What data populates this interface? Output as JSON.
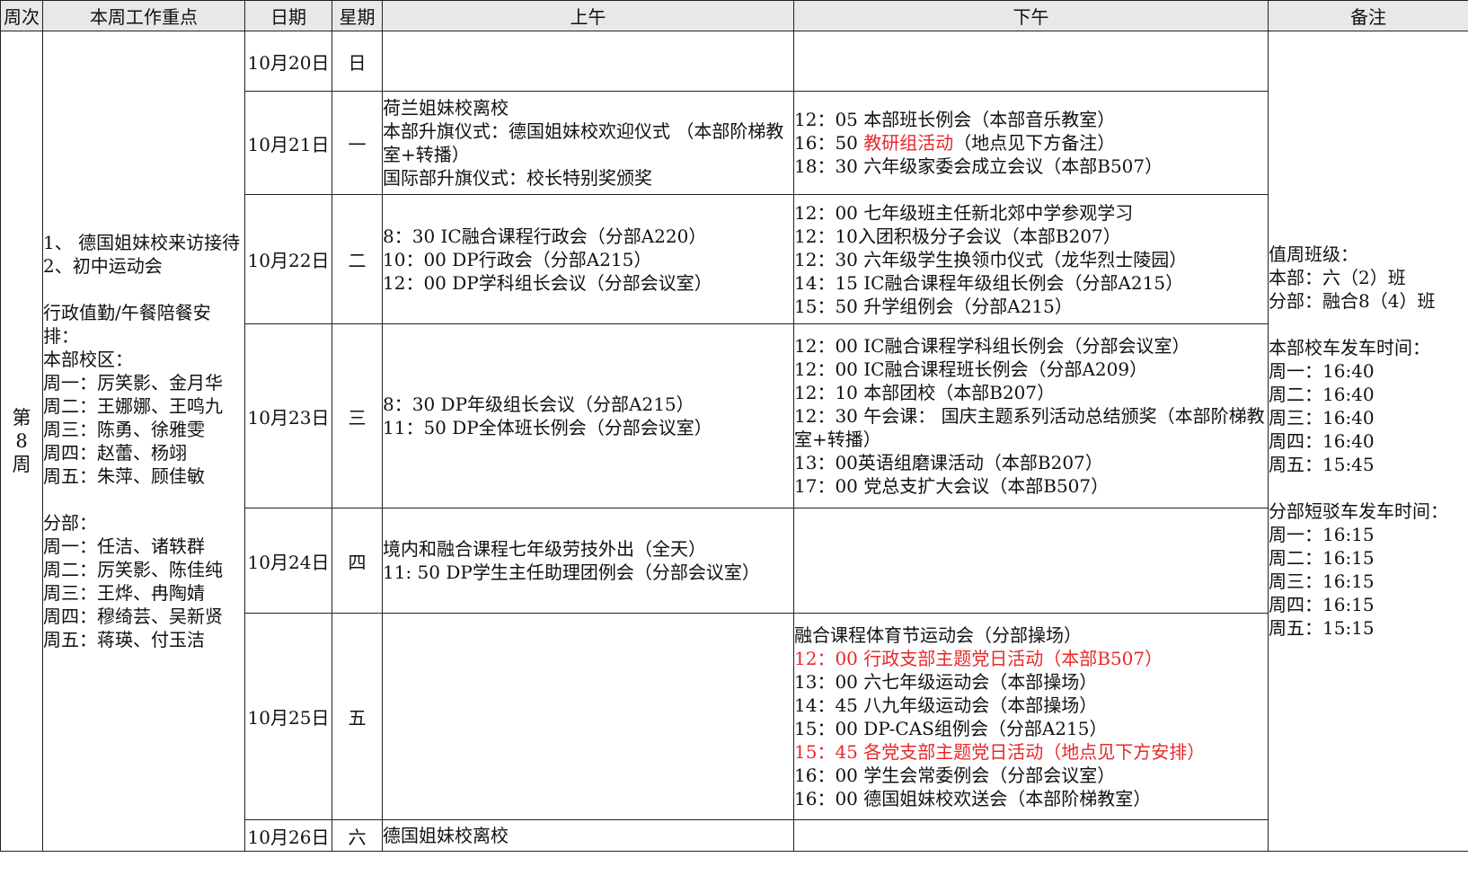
{
  "headers": {
    "week": "周次",
    "focus": "本周工作重点",
    "date": "日期",
    "weekday": "星期",
    "morning": "上午",
    "afternoon": "下午",
    "notes": "备注"
  },
  "week_label": [
    "第",
    "8",
    "周"
  ],
  "focus": {
    "item1": "1、 德国姐妹校来访接待",
    "item2": "2、初中运动会",
    "duty_title": "行政值勤/午餐陪餐安排：",
    "main_campus_title": "本部校区：",
    "main_campus": [
      "周一：厉笑影、金月华",
      "周二：王娜娜、王鸣九",
      "周三：陈勇、徐雅雯",
      "周四：赵蕾、杨翊",
      "周五：朱萍、顾佳敏"
    ],
    "branch_title": "分部：",
    "branch": [
      "周一：任洁、诸轶群",
      "周二：厉笑影、陈佳纯",
      "周三：王烨、冉陶婧",
      "周四：穆绮芸、吴新贤",
      "周五：蒋瑛、付玉洁"
    ]
  },
  "days": [
    {
      "date": "10月20日",
      "weekday": "日",
      "am": [],
      "pm": []
    },
    {
      "date": "10月21日",
      "weekday": "一",
      "am": [
        "荷兰姐妹校离校",
        "本部升旗仪式：德国姐妹校欢迎仪式 （本部阶梯教室+转播）",
        "国际部升旗仪式：校长特别奖颁奖"
      ],
      "pm": [
        "12：05 本部班长例会（本部音乐教室）",
        "16：50 ",
        "教研组活动",
        "（地点见下方备注）",
        "18：30 六年级家委会成立会议（本部B507）"
      ]
    },
    {
      "date": "10月22日",
      "weekday": "二",
      "am": [
        "8：30 IC融合课程行政会（分部A220）",
        "10：00 DP行政会（分部A215）",
        "12：00 DP学科组长会议（分部会议室）"
      ],
      "pm": [
        "12：00 七年级班主任新北郊中学参观学习",
        "12：10入团积极分子会议（本部B207）",
        "12：30 六年级学生换领巾仪式（龙华烈士陵园）",
        "14：15 IC融合课程年级组长例会（分部A215）",
        "15：50 升学组例会（分部A215）"
      ]
    },
    {
      "date": "10月23日",
      "weekday": "三",
      "am": [
        "8：30 DP年级组长会议（分部A215）",
        "11：50 DP全体班长例会（分部会议室）"
      ],
      "pm": [
        "12：00 IC融合课程学科组长例会（分部会议室）",
        "12：00 IC融合课程班长例会（分部A209）",
        "12：10 本部团校（本部B207）",
        "12：30 午会课： 国庆主题系列活动总结颁奖（本部阶梯教室+转播）",
        "13：00英语组磨课活动（本部B207）",
        "17：00 党总支扩大会议（本部B507）"
      ]
    },
    {
      "date": "10月24日",
      "weekday": "四",
      "am": [
        "境内和融合课程七年级劳技外出（全天）",
        "11: 50 DP学生主任助理团例会（分部会议室）"
      ],
      "pm": []
    },
    {
      "date": "10月25日",
      "weekday": "五",
      "am": [],
      "pm": [
        "融合课程体育节运动会（分部操场）",
        "12：00 行政支部主题党日活动（本部B507）",
        "13：00 六七年级运动会（本部操场）",
        "14：45 八九年级运动会（本部操场）",
        "15：00 DP-CAS组例会（分部A215）",
        "15：45 各党支部主题党日活动（地点见下方安排）",
        "16：00 学生会常委例会（分部会议室）",
        "16：00 德国姐妹校欢送会（本部阶梯教室）"
      ]
    },
    {
      "date": "10月26日",
      "weekday": "六",
      "am": [
        "德国姐妹校离校"
      ],
      "pm": []
    }
  ],
  "notes": {
    "duty_class_title": "值周班级：",
    "duty_class": [
      "本部：六（2）班",
      "分部：融合8（4）班"
    ],
    "bus_title": "本部校车发车时间：",
    "bus": [
      "周一：16:40",
      "周二：16:40",
      "周三：16:40",
      "周四：16:40",
      "周五：15:45"
    ],
    "shuttle_title": "分部短驳车发车时间：",
    "shuttle": [
      "周一：16:15",
      "周二：16:15",
      "周三：16:15",
      "周四：16:15",
      "周五：15:15"
    ]
  },
  "colors": {
    "highlight": "#e8282a",
    "header_bg": "#e8e8e8",
    "border": "#222222"
  }
}
